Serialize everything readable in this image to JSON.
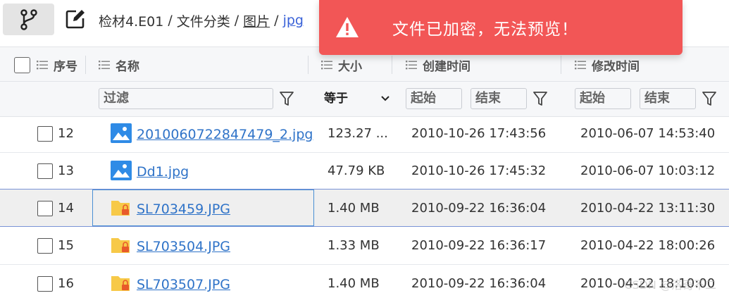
{
  "breadcrumb": {
    "items": [
      "检材4.E01",
      "文件分类",
      "图片",
      "jpg"
    ],
    "separator": "/"
  },
  "toast": {
    "message": "文件已加密，无法预览！",
    "color": "#f25656"
  },
  "columns": {
    "index": "序号",
    "name": "名称",
    "size": "大小",
    "created": "创建时间",
    "modified": "修改时间"
  },
  "filters": {
    "name_placeholder": "过滤",
    "size_operator": "等于",
    "created_start": "起始",
    "created_end": "结束",
    "modified_start": "起始",
    "modified_end": "结束"
  },
  "rows": [
    {
      "index": "12",
      "name": "2010060722847479_2.jpg",
      "size": "123.27 ...",
      "created": "2010-10-26 17:43:56",
      "modified": "2010-06-07 14:53:40",
      "icon": "image-file-icon"
    },
    {
      "index": "13",
      "name": "Dd1.jpg",
      "size": "47.79 KB",
      "created": "2010-10-26 17:45:32",
      "modified": "2010-06-07 10:03:12",
      "icon": "image-file-icon"
    },
    {
      "index": "14",
      "name": "SL703459.JPG",
      "size": "1.40 MB",
      "created": "2010-09-22 16:36:04",
      "modified": "2010-04-22 13:11:30",
      "icon": "encrypted-folder-icon"
    },
    {
      "index": "15",
      "name": "SL703504.JPG",
      "size": "1.33 MB",
      "created": "2010-09-22 16:36:17",
      "modified": "2010-04-22 18:00:26",
      "icon": "encrypted-folder-icon"
    },
    {
      "index": "16",
      "name": "SL703507.JPG",
      "size": "1.40 MB",
      "created": "2010-09-22 16:36:04",
      "modified": "2010-04-22 18:10:00",
      "icon": "encrypted-folder-icon"
    }
  ],
  "watermark": "CSDN @洛奇不二"
}
